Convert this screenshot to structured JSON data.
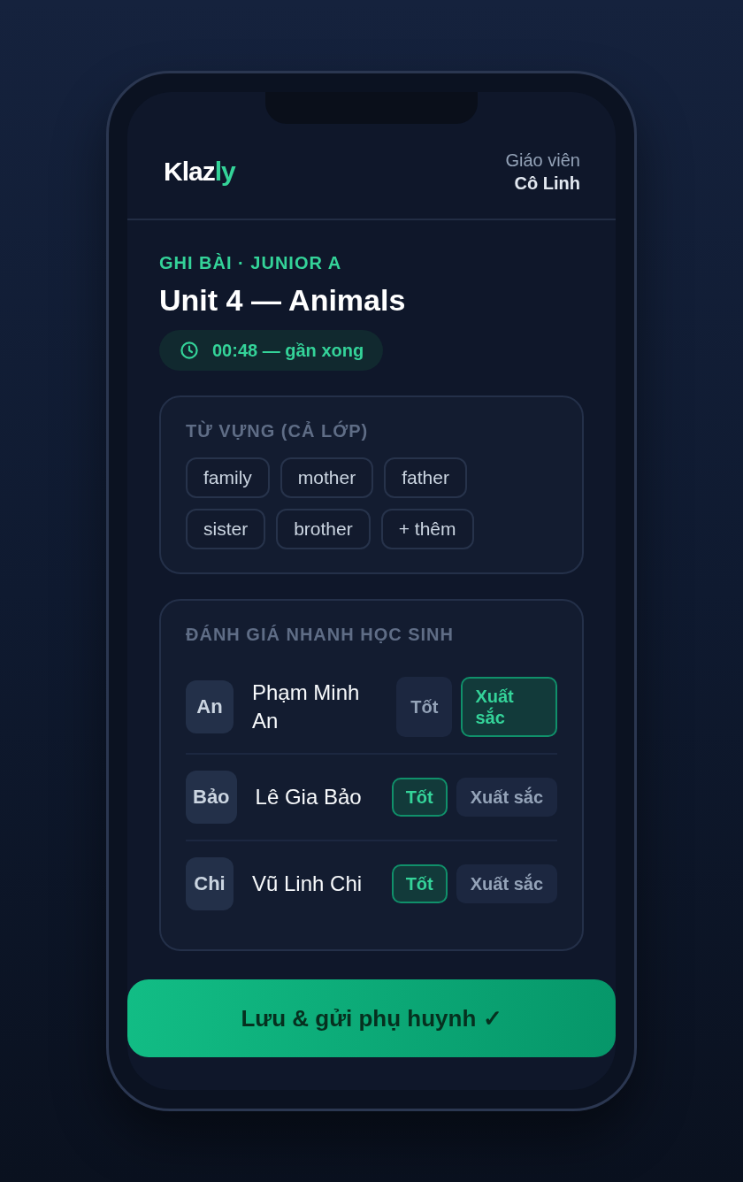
{
  "header": {
    "brand": {
      "name": "Klaz",
      "accent": "ly"
    },
    "role": "Giáo viên",
    "user": "Cô Linh"
  },
  "lesson": {
    "eyebrow": "GHI BÀI · JUNIOR A",
    "title": "Unit 4 — Animals",
    "timer": "00:48 — gần xong"
  },
  "vocabulary": {
    "title": "TỪ VỰNG (CẢ LỚP)",
    "chips": [
      "family",
      "mother",
      "father",
      "sister",
      "brother",
      "+ thêm"
    ]
  },
  "assessment": {
    "title": "ĐÁNH GIÁ NHANH HỌC SINH",
    "students": [
      {
        "initials": "An",
        "name": "Phạm Minh An",
        "grades": [
          {
            "label": "Tốt",
            "selected": false
          },
          {
            "label": "Xuất sắc",
            "selected": true
          }
        ]
      },
      {
        "initials": "Bảo",
        "name": "Lê Gia Bảo",
        "grades": [
          {
            "label": "Tốt",
            "selected": true
          },
          {
            "label": "Xuất sắc",
            "selected": false
          }
        ]
      },
      {
        "initials": "Chi",
        "name": "Vũ Linh Chi",
        "grades": [
          {
            "label": "Tốt",
            "selected": true
          },
          {
            "label": "Xuất sắc",
            "selected": false
          }
        ]
      }
    ]
  },
  "submit_button": {
    "label": "Lưu & gửi phụ huynh ✓"
  }
}
